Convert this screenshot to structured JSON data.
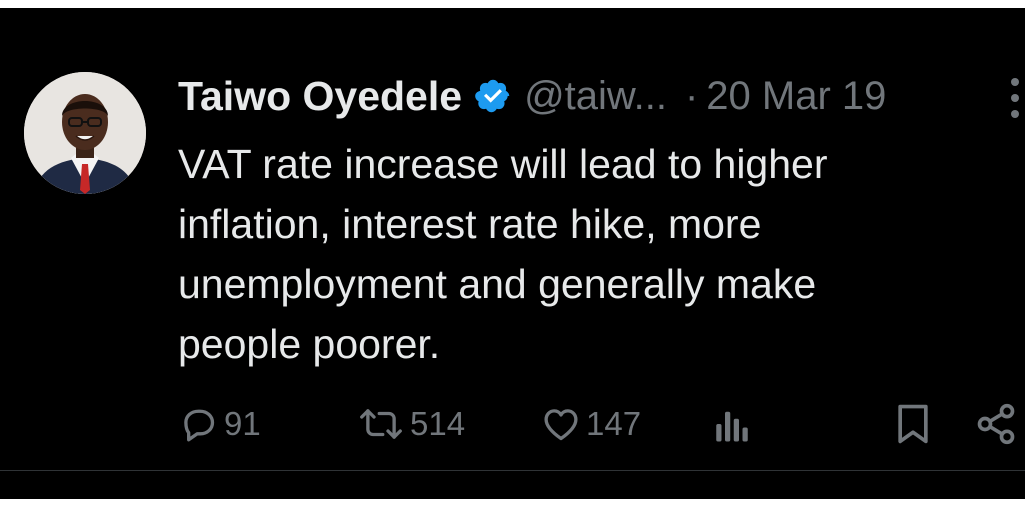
{
  "tweet": {
    "author": {
      "display_name": "Taiwo Oyedele",
      "handle": "@taiw...",
      "verified": true,
      "avatar": "profile-photo"
    },
    "separator": "·",
    "date": "20 Mar 19",
    "text_lines": [
      "VAT rate increase will lead to higher",
      "inflation, interest rate hike, more",
      "unemployment and generally make",
      "people poorer."
    ],
    "actions": {
      "replies": {
        "icon": "reply-icon",
        "count": "91"
      },
      "reposts": {
        "icon": "repost-icon",
        "count": "514"
      },
      "likes": {
        "icon": "like-icon",
        "count": "147"
      },
      "views": {
        "icon": "views-icon"
      },
      "bookmark": {
        "icon": "bookmark-icon"
      },
      "share": {
        "icon": "share-icon"
      }
    }
  },
  "colors": {
    "background": "#000000",
    "text_primary": "#e7e9ea",
    "text_secondary": "#71767b",
    "verified_badge": "#1d9bf0",
    "divider": "#2f3336"
  }
}
